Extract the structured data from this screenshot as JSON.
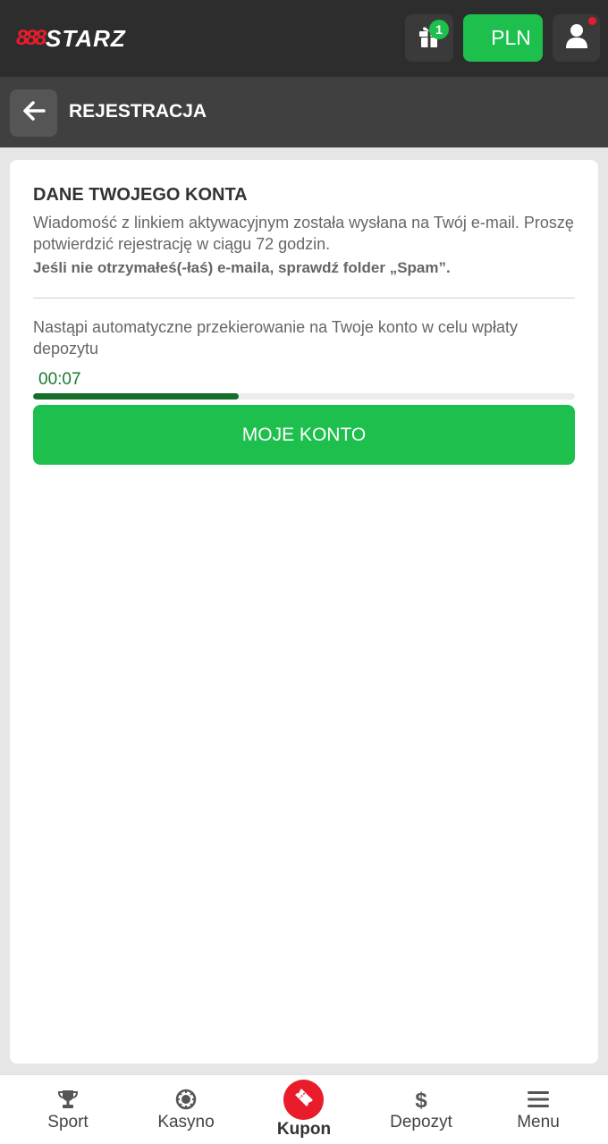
{
  "header": {
    "logo_mark": "888",
    "logo_text": "STARZ",
    "gift_count": "1",
    "currency_label": "PLN"
  },
  "subheader": {
    "title": "REJESTRACJA"
  },
  "content": {
    "heading": "DANE TWOJEGO KONTA",
    "info": "Wiadomość z linkiem aktywacyjnym została wysłana na Twój e-mail. Proszę potwierdzić rejestrację w ciągu 72 godzin.",
    "info_bold": "Jeśli nie otrzymałeś(-łaś) e-maila, sprawdź folder „Spam”.",
    "redirect_text": "Nastąpi automatyczne przekierowanie na Twoje konto w celu wpłaty depozytu",
    "timer": "00:07",
    "progress_fraction": 0.38,
    "button_label": "MOJE KONTO"
  },
  "bottom_nav": {
    "sport": "Sport",
    "kasyno": "Kasyno",
    "kupon": "Kupon",
    "depozyt": "Depozyt",
    "menu": "Menu"
  },
  "colors": {
    "accent_green": "#1dbf4d",
    "brand_red": "#e81c2a",
    "header_bg": "#2d2d2d",
    "progress_fill": "#176e2b"
  },
  "icons": {
    "gift": "gift-icon",
    "user": "user-icon",
    "back": "arrow-left-icon",
    "sport": "trophy-icon",
    "kasyno": "casino-chip-icon",
    "kupon": "ticket-icon",
    "depozyt": "dollar-icon",
    "menu": "hamburger-icon"
  }
}
